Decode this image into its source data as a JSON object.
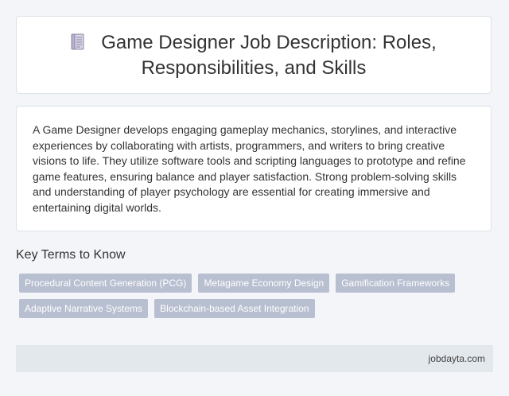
{
  "header": {
    "icon": "document-icon",
    "title": "Game Designer Job Description: Roles, Responsibilities, and Skills"
  },
  "description": {
    "text": "A Game Designer develops engaging gameplay mechanics, storylines, and interactive experiences by collaborating with artists, programmers, and writers to bring creative visions to life. They utilize software tools and scripting languages to prototype and refine game features, ensuring balance and player satisfaction. Strong problem-solving skills and understanding of player psychology are essential for creating immersive and entertaining digital worlds."
  },
  "key_terms": {
    "heading": "Key Terms to Know",
    "tags": [
      "Procedural Content Generation (PCG)",
      "Metagame Economy Design",
      "Gamification Frameworks",
      "Adaptive Narrative Systems",
      "Blockchain-based Asset Integration"
    ]
  },
  "footer": {
    "site": "jobdayta.com"
  },
  "colors": {
    "page_background": "#f3f5f8",
    "card_background": "#ffffff",
    "tag_background": "#b8bfd0",
    "footer_background": "#e3e8ec"
  }
}
